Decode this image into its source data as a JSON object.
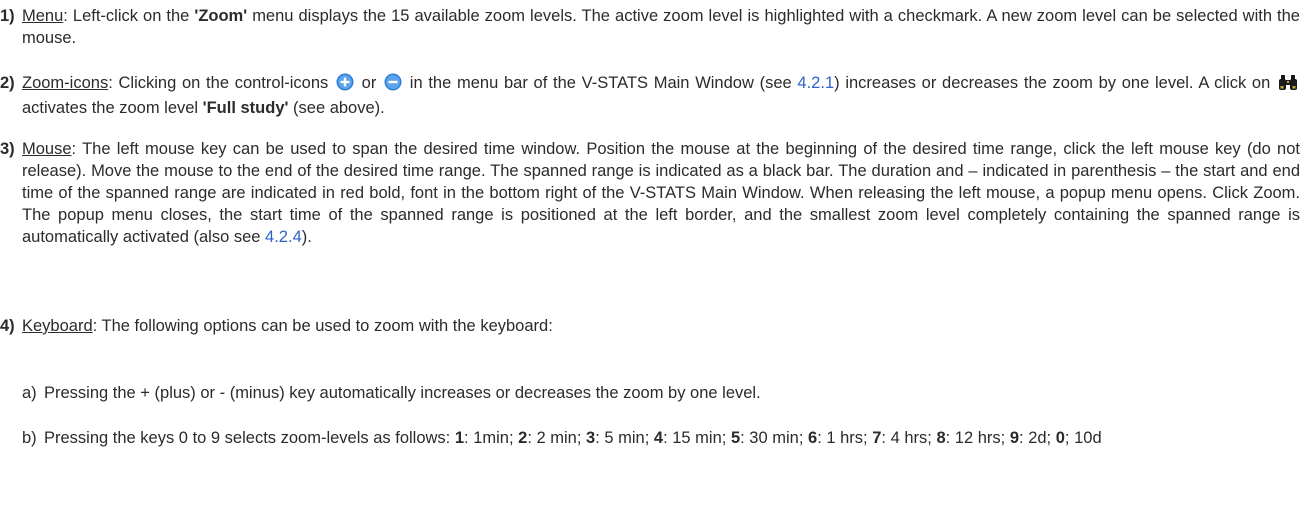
{
  "items": [
    {
      "num": "1)",
      "label": "Menu",
      "p1": ": Left-click on the ",
      "menu_name": "'Zoom'",
      "p2": " menu displays the 15 available zoom levels. The active zoom level is highlighted with a checkmark. A new zoom level can be selected with the mouse."
    },
    {
      "num": "2)",
      "label": "Zoom-icons",
      "p1": ": Clicking on the control-icons ",
      "p2": " or ",
      "p3": " in the menu bar of the V-STATS Main Window (see ",
      "link": "4.2.1",
      "p4": ") increases or decreases the zoom by one level. A click on ",
      "p5": " activates the zoom level ",
      "zoom_name": "'Full study'",
      "p6": " (see above)."
    },
    {
      "num": "3)",
      "label": "Mouse",
      "p1": ": The left mouse key can be used to span the desired time window. Position the mouse at the beginning of the desired time range, click the left mouse key (do not release). Move the mouse to the end of the desired time range. The spanned range is indicated as a black bar. The duration and – indicated in parenthesis – the start and end time of the spanned range are indicated in red bold, font in the bottom right of the V-STATS Main Window. When releasing the left mouse, a popup menu opens. Click Zoom. The popup menu closes, the start time of the spanned range is positioned at the left border, and the smallest zoom level completely containing the spanned range is automatically activated (also see ",
      "link": "4.2.4",
      "p2": ")."
    },
    {
      "num": "4)",
      "label": "Keyboard",
      "p1": ": The following options can be used to zoom with the keyboard:"
    }
  ],
  "sub": [
    {
      "letter": "a)",
      "text": "Pressing the + (plus) or - (minus) key automatically increases or decreases the zoom by one level."
    },
    {
      "letter": "b)",
      "lead": "Pressing the keys 0 to 9 selects zoom-levels as follows: ",
      "keys": [
        {
          "k": "1",
          "v": ": 1min; "
        },
        {
          "k": "2",
          "v": ": 2 min; "
        },
        {
          "k": "3",
          "v": ": 5 min; "
        },
        {
          "k": "4",
          "v": ": 15 min; "
        },
        {
          "k": "5",
          "v": ": 30 min; "
        },
        {
          "k": "6",
          "v": ": 1 hrs; "
        },
        {
          "k": "7",
          "v": ": 4 hrs; "
        },
        {
          "k": "8",
          "v": ": 12 hrs; "
        },
        {
          "k": "9",
          "v": ": 2d; "
        },
        {
          "k": "0",
          "v": "; 10d"
        }
      ]
    }
  ],
  "icons": {
    "zoom_in": "plus-circle-icon",
    "zoom_out": "minus-circle-icon",
    "full_study": "binoculars-icon",
    "accent": "#2f7fd6",
    "link_color": "#2e62c9"
  }
}
